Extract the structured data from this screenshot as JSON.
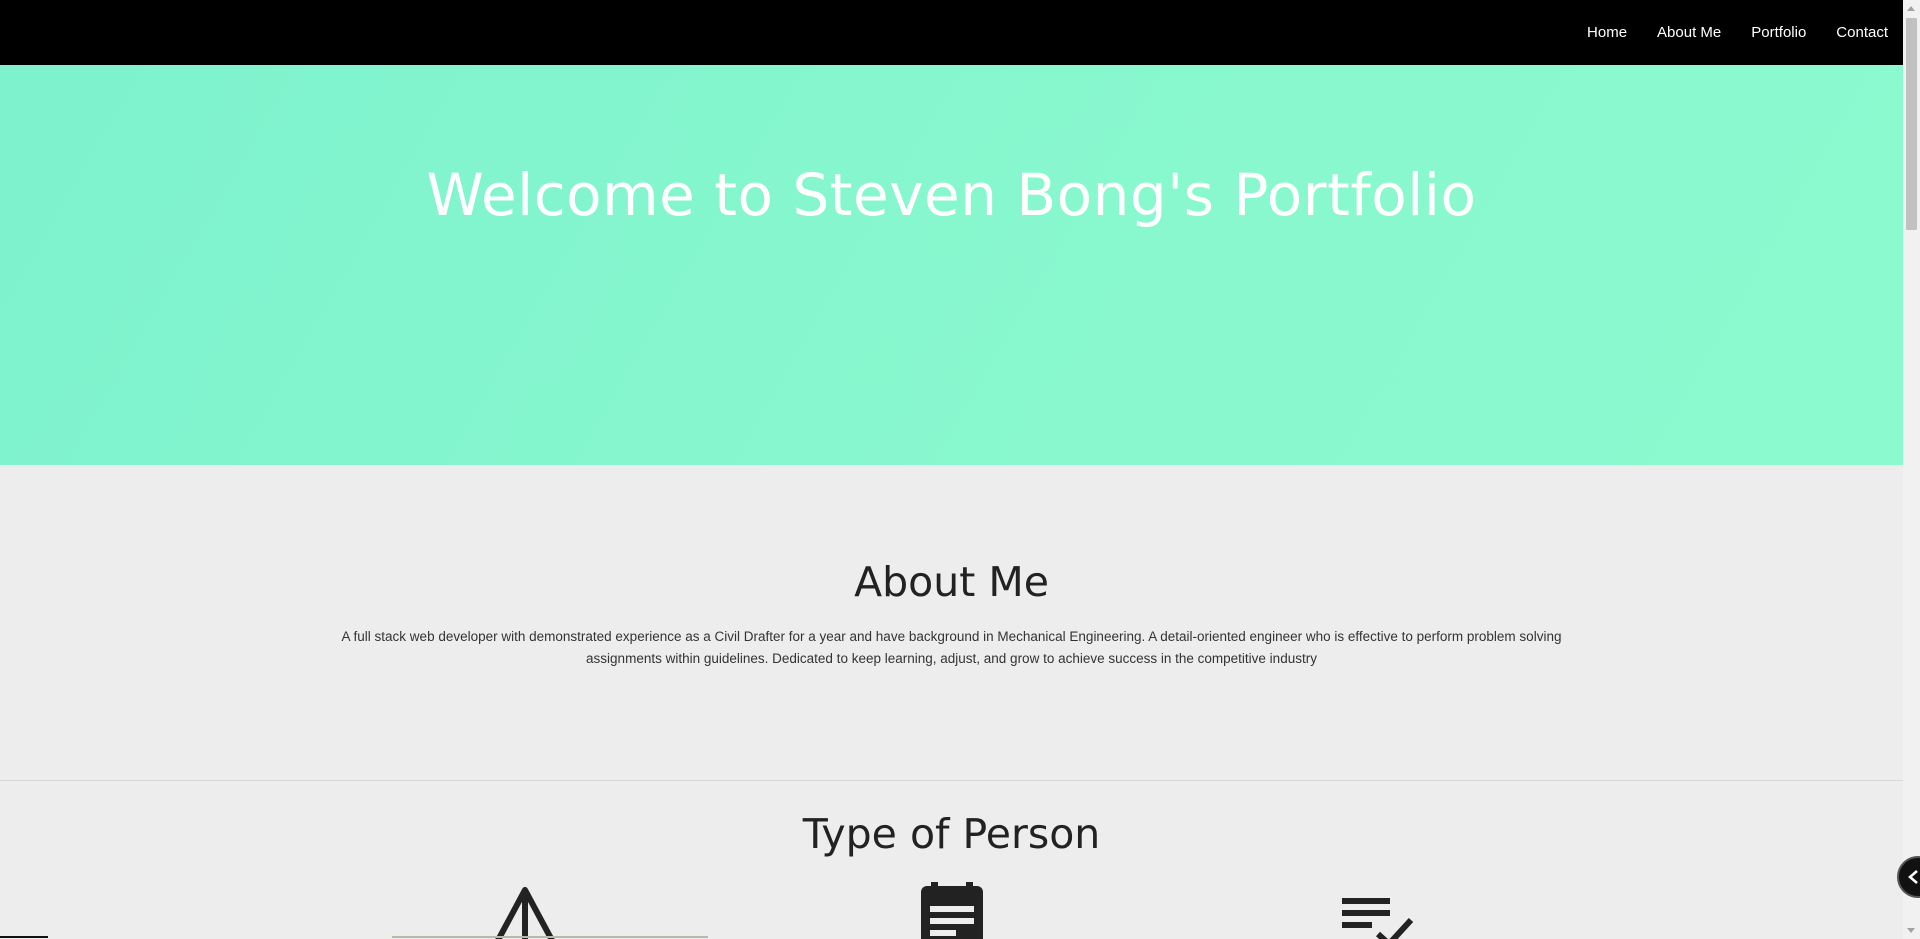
{
  "nav": {
    "items": [
      {
        "label": "Home"
      },
      {
        "label": "About Me"
      },
      {
        "label": "Portfolio"
      },
      {
        "label": "Contact"
      }
    ]
  },
  "hero": {
    "title": "Welcome to Steven Bong's Portfolio",
    "background_color": "#88f7cf"
  },
  "about": {
    "title": "About Me",
    "text": "A full stack web developer with demonstrated experience as a Civil Drafter for a year and have background in Mechanical Engineering. A detail-oriented engineer who is effective to perform problem solving assignments within guidelines. Dedicated to keep learning, adjust, and grow to achieve success in the competitive industry"
  },
  "type_of_person": {
    "title": "Type of Person",
    "icons": [
      "arrow-up-icon",
      "calendar-note-icon",
      "checklist-icon"
    ]
  },
  "floating_button": {
    "icon": "chevron-left-icon"
  }
}
